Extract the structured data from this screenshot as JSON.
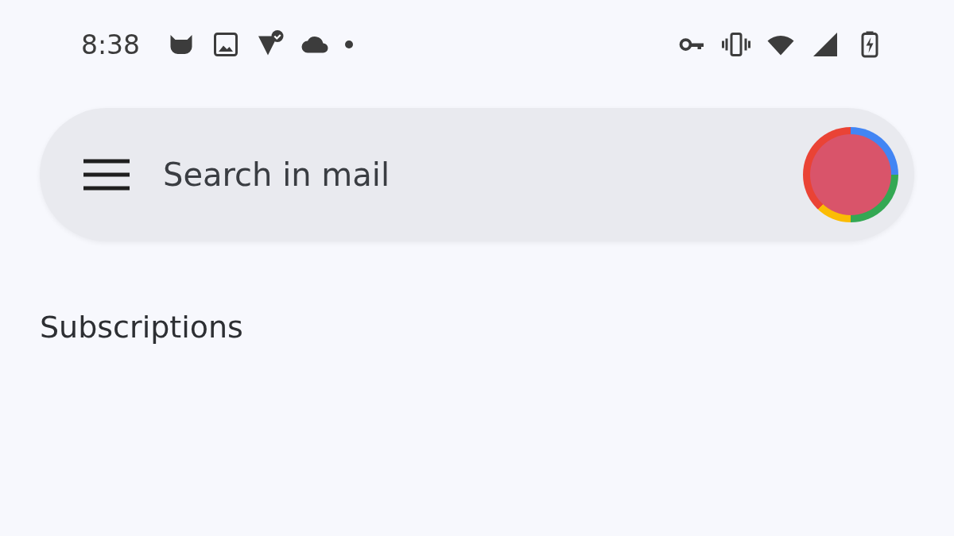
{
  "status_bar": {
    "time": "8:38"
  },
  "search": {
    "placeholder": "Search in mail"
  },
  "section": {
    "title": "Subscriptions"
  }
}
